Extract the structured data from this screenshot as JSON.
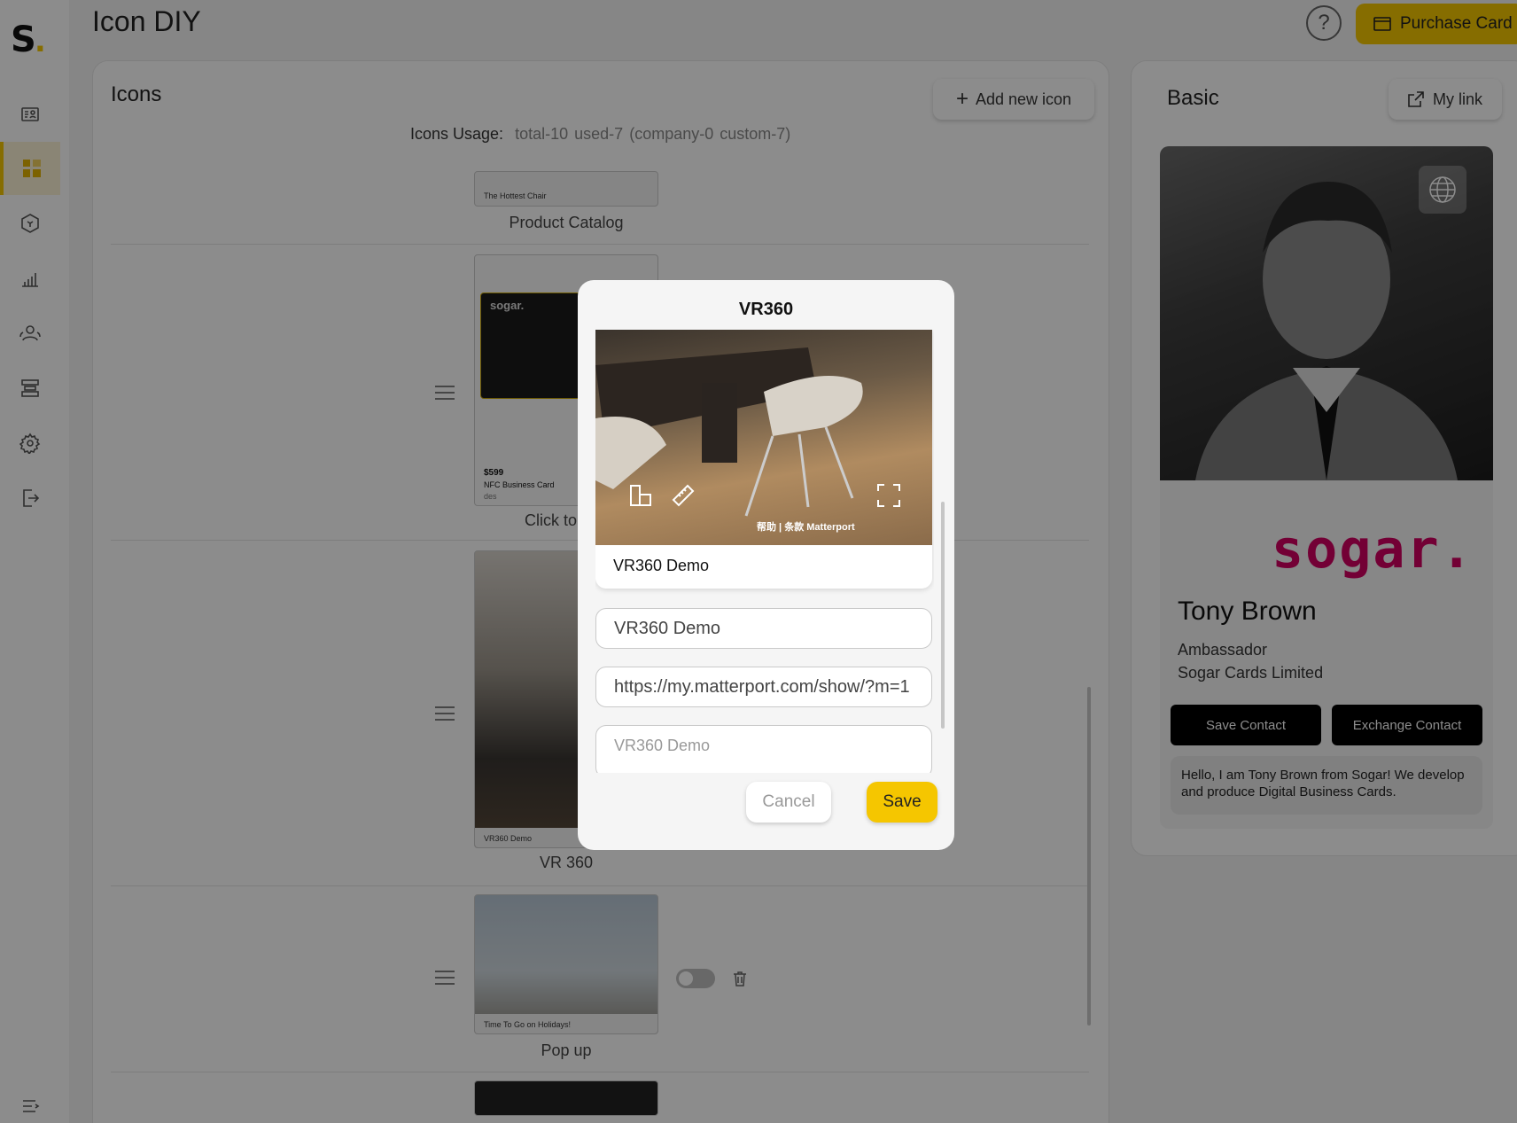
{
  "app": {
    "logo_text": "S",
    "page_title": "Icon DIY"
  },
  "header": {
    "help_symbol": "?",
    "purchase_label": "Purchase Card"
  },
  "sidebar": {
    "items": [
      {
        "icon": "contact-card-icon",
        "active": false
      },
      {
        "icon": "grid-icon",
        "active": true
      },
      {
        "icon": "cube-icon",
        "active": false
      },
      {
        "icon": "bar-chart-icon",
        "active": false
      },
      {
        "icon": "users-icon",
        "active": false
      },
      {
        "icon": "layers-icon",
        "active": false
      },
      {
        "icon": "gear-icon",
        "active": false
      },
      {
        "icon": "logout-icon",
        "active": false
      }
    ],
    "collapse_icon": "menu-collapse-icon"
  },
  "icons_panel": {
    "title": "Icons",
    "add_label": "Add new icon",
    "usage_label": "Icons Usage:",
    "usage_total": "total-10",
    "usage_used": "used-7",
    "usage_detail": "(company-0",
    "usage_custom": "custom-7)",
    "rows": [
      {
        "caption": "Product Catalog",
        "thumb_text": "The Hottest Chair"
      },
      {
        "caption": "Click to",
        "thumb_brand": "sogar.",
        "thumb_price": "$599",
        "thumb_product": "NFC Business Card",
        "thumb_desc": "des"
      },
      {
        "caption": "VR 360",
        "thumb_text": "VR360 Demo"
      },
      {
        "caption": "Pop up",
        "thumb_text": "Time To Go on Holidays!"
      }
    ]
  },
  "basic_panel": {
    "title": "Basic",
    "mylink_label": "My link",
    "card": {
      "brand": "sogar.",
      "name": "Tony Brown",
      "role": "Ambassador",
      "company": "Sogar Cards Limited",
      "save_contact": "Save Contact",
      "exchange_contact": "Exchange Contact",
      "bio": "Hello, I am Tony Brown from Sogar! We develop and produce Digital Business Cards."
    }
  },
  "dialog": {
    "title": "VR360",
    "preview_title": "VR360 Demo",
    "preview_footer": "帮助  |  条款   Matterport",
    "title_field_value": "VR360 Demo",
    "url_field_value": "https://my.matterport.com/show/?m=1",
    "desc_field_placeholder": "VR360 Demo",
    "cancel_label": "Cancel",
    "save_label": "Save"
  },
  "colors": {
    "accent": "#f5c600",
    "brand_pink": "#d10062"
  }
}
